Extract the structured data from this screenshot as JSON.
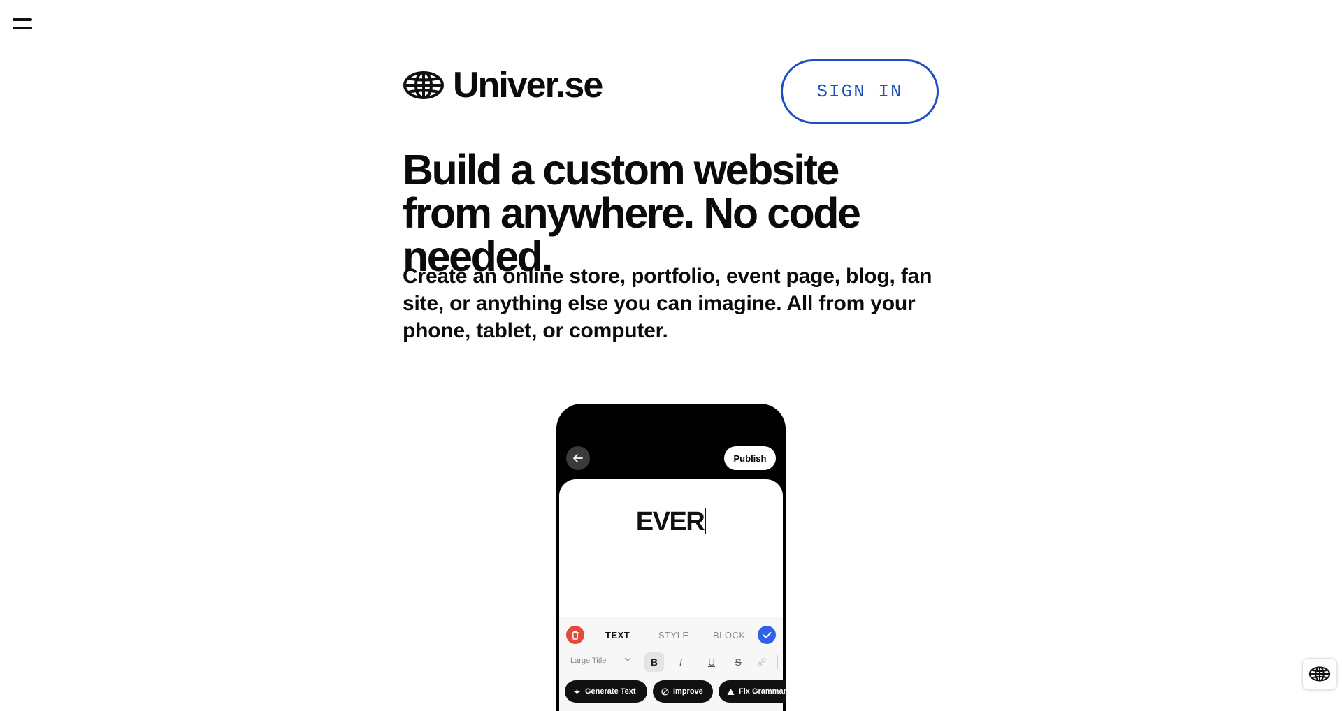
{
  "brand": {
    "name": "Univer.se",
    "logo_icon": "globe-icon"
  },
  "header": {
    "menu_icon": "hamburger-menu-icon",
    "signin_label": "SIGN IN"
  },
  "hero": {
    "headline": "Build a custom website from anywhere. No code needed.",
    "subtext": "Create an online store, portfolio, event page, blog, fan site, or anything else you can imagine. All from your phone, tablet, or computer."
  },
  "phone": {
    "publish_label": "Publish",
    "editor_text": "EVER",
    "tabs": [
      "TEXT",
      "STYLE",
      "BLOCK"
    ],
    "style_select": "Large Title",
    "format_buttons": [
      "B",
      "I",
      "U",
      "S"
    ],
    "ai_actions": [
      "Generate Text",
      "Improve",
      "Fix Grammar"
    ]
  },
  "colors": {
    "accent": "#1e4fc2",
    "text": "#0b0b0b",
    "delete": "#e4493f",
    "confirm": "#2f62e6"
  },
  "footer": {
    "language_icon": "globe-icon"
  }
}
